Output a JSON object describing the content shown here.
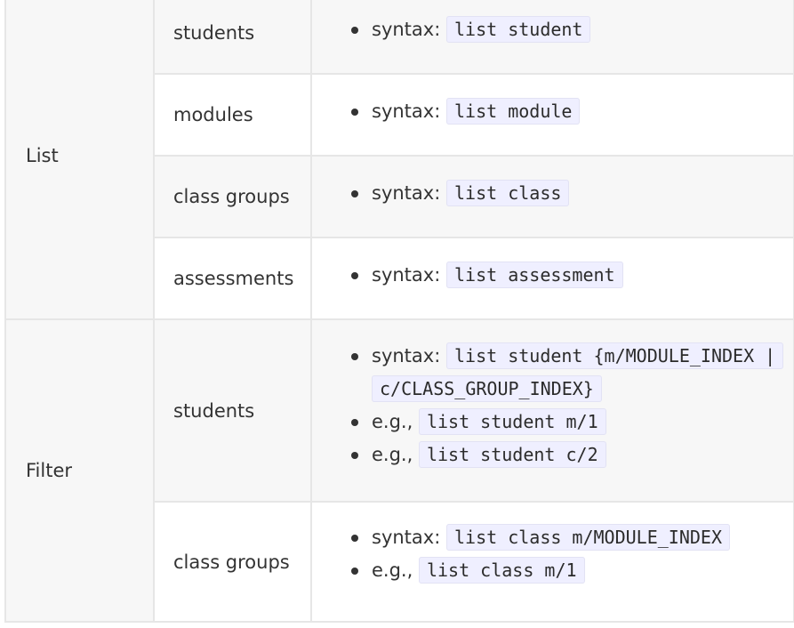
{
  "table": {
    "groups": [
      {
        "category": "List",
        "rows": [
          {
            "item": "students",
            "lines": [
              {
                "prefix": "syntax:",
                "code": "list student"
              }
            ]
          },
          {
            "item": "modules",
            "lines": [
              {
                "prefix": "syntax:",
                "code": "list module"
              }
            ]
          },
          {
            "item": "class groups",
            "lines": [
              {
                "prefix": "syntax:",
                "code": "list class"
              }
            ]
          },
          {
            "item": "assessments",
            "lines": [
              {
                "prefix": "syntax:",
                "code": "list assessment"
              }
            ]
          }
        ]
      },
      {
        "category": "Filter",
        "rows": [
          {
            "item": "students",
            "lines": [
              {
                "prefix": "syntax:",
                "code": "list student {m/MODULE_INDEX | c/CLASS_GROUP_INDEX}"
              },
              {
                "prefix": "e.g.,",
                "code": "list student m/1"
              },
              {
                "prefix": "e.g.,",
                "code": "list student c/2"
              }
            ]
          },
          {
            "item": "class groups",
            "lines": [
              {
                "prefix": "syntax:",
                "code": "list class m/MODULE_INDEX"
              },
              {
                "prefix": "e.g.,",
                "code": "list class m/1"
              }
            ]
          }
        ]
      }
    ]
  }
}
